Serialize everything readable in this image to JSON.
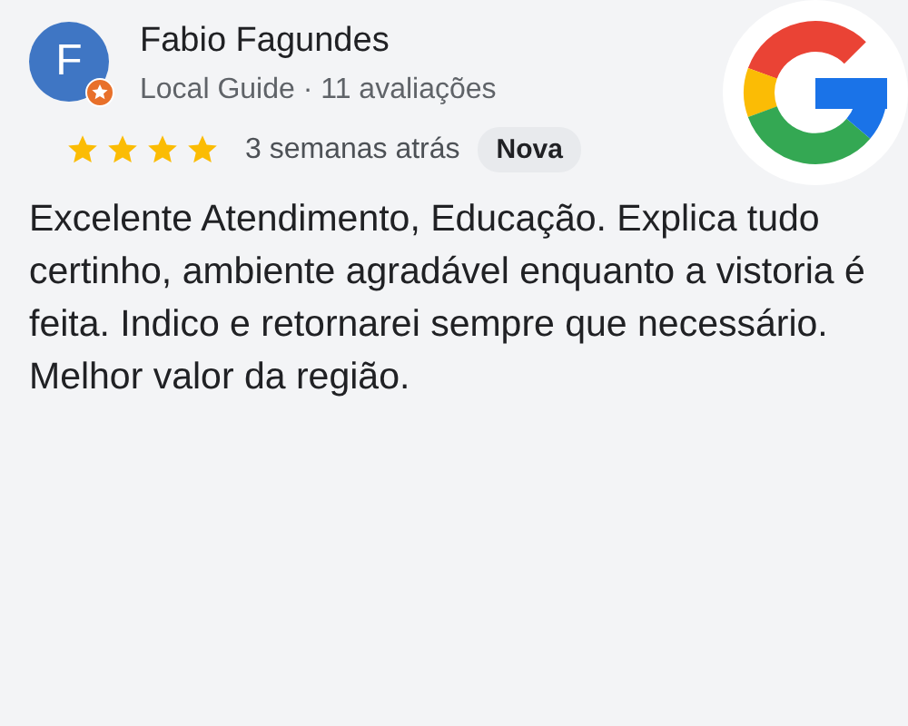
{
  "review": {
    "avatar_letter": "F",
    "author": "Fabio Fagundes",
    "subtitle": "Local Guide · 11 avaliações",
    "stars": 4,
    "time": "3 semanas atrás",
    "badge": "Nova",
    "text": "Excelente Atendimento, Educação. Explica tudo certinho, ambiente agradável enquanto a vistoria é feita. Indico e retornarei sempre que necessário. Melhor valor da região."
  }
}
